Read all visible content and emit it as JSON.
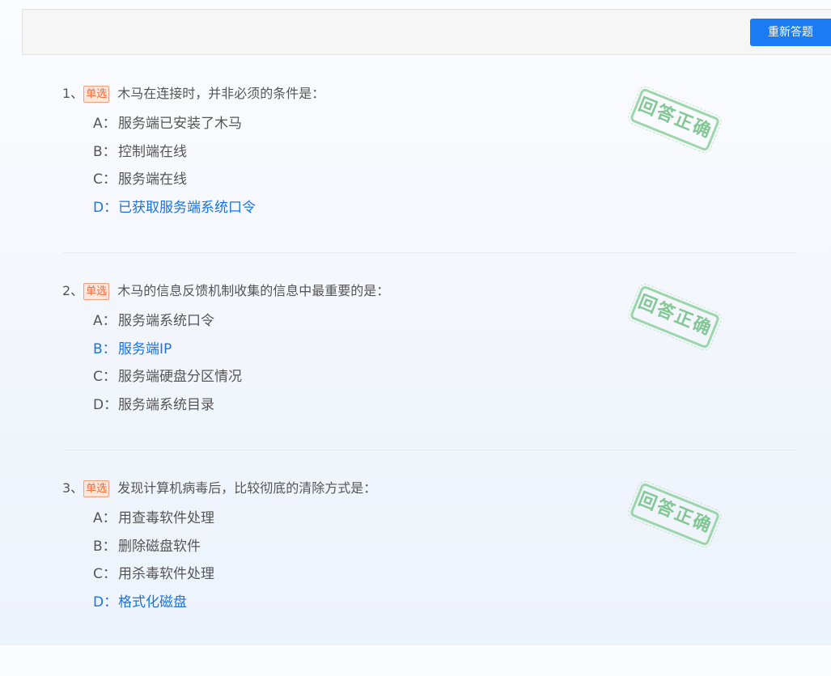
{
  "toolbar": {
    "redo_label": "重新答题"
  },
  "questions": [
    {
      "number": "1、",
      "type": "单选",
      "text": "木马在连接时，并非必须的条件是：",
      "options": [
        {
          "letter": "A：",
          "text": "服务端已安装了木马"
        },
        {
          "letter": "B：",
          "text": "控制端在线"
        },
        {
          "letter": "C：",
          "text": "服务端在线"
        },
        {
          "letter": "D：",
          "text": "已获取服务端系统口令"
        }
      ],
      "selected": "D",
      "stamp": "回答正确"
    },
    {
      "number": "2、",
      "type": "单选",
      "text": "木马的信息反馈机制收集的信息中最重要的是：",
      "options": [
        {
          "letter": "A：",
          "text": "服务端系统口令"
        },
        {
          "letter": "B：",
          "text": "服务端IP"
        },
        {
          "letter": "C：",
          "text": "服务端硬盘分区情况"
        },
        {
          "letter": "D：",
          "text": "服务端系统目录"
        }
      ],
      "selected": "B",
      "stamp": "回答正确"
    },
    {
      "number": "3、",
      "type": "单选",
      "text": "发现计算机病毒后，比较彻底的清除方式是：",
      "options": [
        {
          "letter": "A：",
          "text": "用查毒软件处理"
        },
        {
          "letter": "B：",
          "text": "删除磁盘软件"
        },
        {
          "letter": "C：",
          "text": "用杀毒软件处理"
        },
        {
          "letter": "D：",
          "text": "格式化磁盘"
        }
      ],
      "selected": "D",
      "stamp": "回答正确"
    }
  ],
  "colors": {
    "accent": "#1a7bf2",
    "selected_option": "#1a74e0",
    "badge": "#f26b3a",
    "stamp": "#6fbf83"
  }
}
